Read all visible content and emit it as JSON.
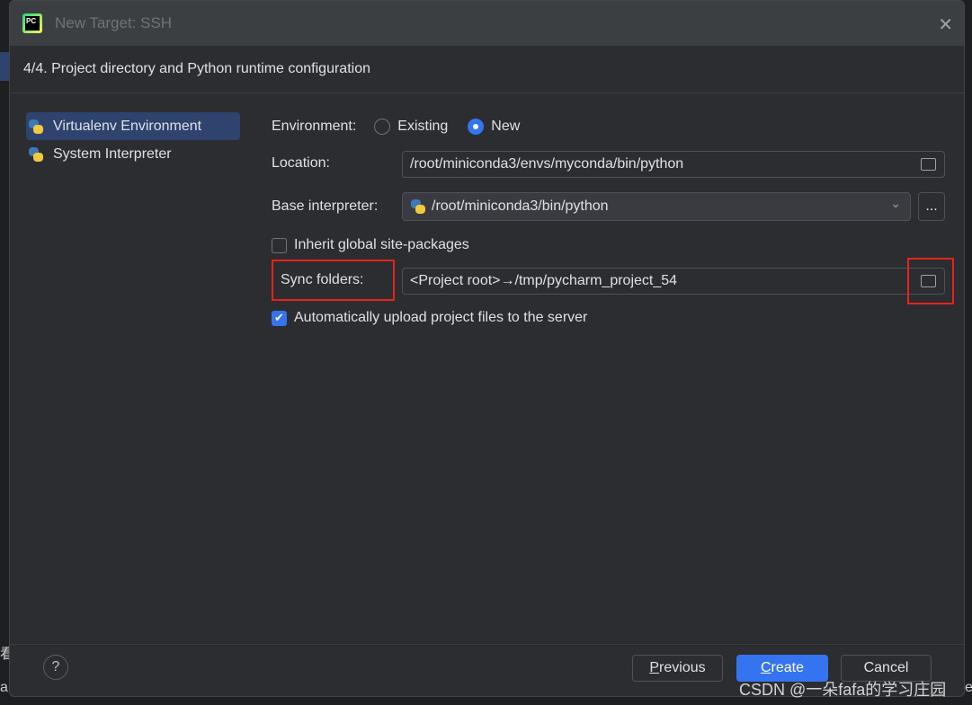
{
  "window": {
    "title": "New Target: SSH",
    "logo_text": "PC"
  },
  "step": "4/4. Project directory and Python runtime configuration",
  "sidebar": {
    "items": [
      {
        "label": "Virtualenv Environment",
        "selected": true,
        "icon": "python-virtualenv-icon"
      },
      {
        "label": "System Interpreter",
        "selected": false,
        "icon": "python-icon"
      }
    ]
  },
  "form": {
    "environment_label": "Environment:",
    "env_options": [
      {
        "label": "Existing",
        "checked": false
      },
      {
        "label": "New",
        "checked": true
      }
    ],
    "location_label": "Location:",
    "location_value": "/root/miniconda3/envs/myconda/bin/python",
    "base_label": "Base interpreter:",
    "base_value": "/root/miniconda3/bin/python",
    "browse_label": "...",
    "inherit_label": "Inherit global site-packages",
    "inherit_checked": false,
    "sync_label": "Sync folders:",
    "sync_value": "<Project root>→/tmp/pycharm_project_54",
    "upload_label": "Automatically upload project files to the server",
    "upload_checked": true
  },
  "footer": {
    "help": "?",
    "previous_first": "P",
    "previous_rest": "revious",
    "create_first": "C",
    "create_rest": "reate",
    "cancel": "Cancel"
  },
  "highlight_color": "#e8221b",
  "accent_color": "#3574f0",
  "watermark": "CSDN @一朵fafa的学习庄园",
  "background_fragments": {
    "left1": "看",
    "left2": "a",
    "right": "e"
  }
}
